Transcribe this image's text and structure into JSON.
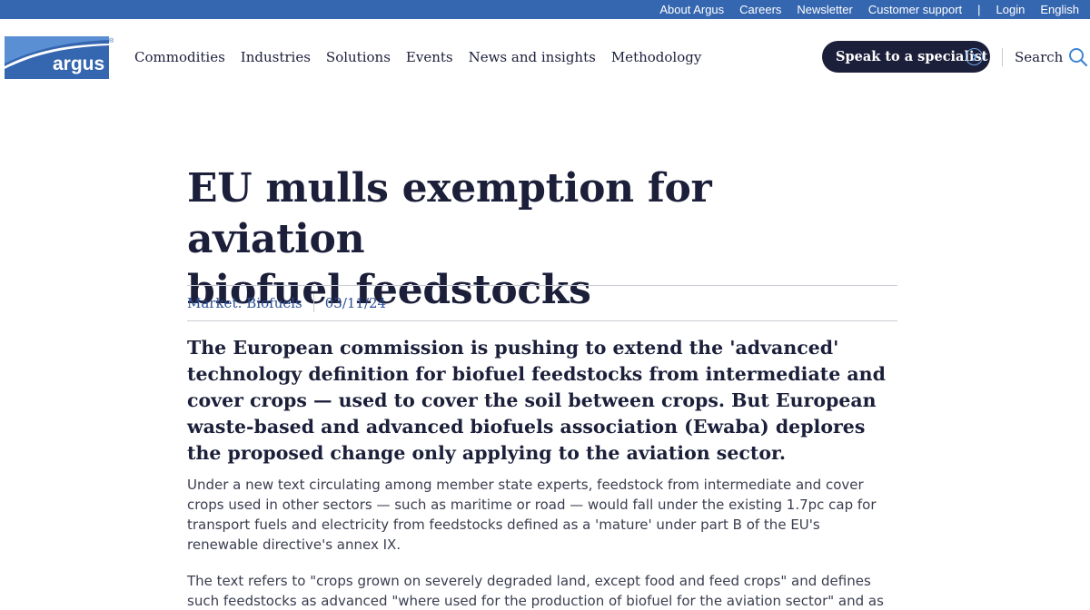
{
  "utility_nav": {
    "about": "About Argus",
    "careers": "Careers",
    "newsletter": "Newsletter",
    "support": "Customer support",
    "separator": "|",
    "login": "Login",
    "language": "English"
  },
  "brand": {
    "logo_text": "argus",
    "logo_mark": "®",
    "color": "#3566b0"
  },
  "main_nav": {
    "items": [
      "Commodities",
      "Industries",
      "Solutions",
      "Events",
      "News and insights",
      "Methodology"
    ]
  },
  "header_actions": {
    "specialist_label": "Speak to a specialist",
    "search_label": "Search"
  },
  "article": {
    "title_line1": "EU mulls exemption for aviation",
    "title_line2": "biofuel feedstocks",
    "market": "Market: Biofuels",
    "date": "03/11/24",
    "lead": "The European commission is pushing to extend the 'advanced' technology definition for biofuel feedstocks from intermediate and cover crops — used to cover the soil between crops. But European waste-based and advanced biofuels association (Ewaba) deplores the proposed change only applying to the aviation sector.",
    "para1": "Under a new text circulating among member state experts, feedstock from intermediate and cover crops used in other sectors — such as maritime or road — would fall under the existing 1.7pc cap for transport fuels and electricity from feedstocks defined as a 'mature' under part B of the EU's renewable directive's annex IX.",
    "para2": "The text refers to \"crops grown on severely degraded land, except food and feed crops\" and defines such feedstocks as advanced \"where used for the production of biofuel for the aviation sector\" and as mature"
  },
  "colors": {
    "navy": "#1c1f3a",
    "utility_blue": "#3566b0",
    "link_blue": "#2b4f97",
    "accent_light_blue": "#6ea6e8"
  }
}
